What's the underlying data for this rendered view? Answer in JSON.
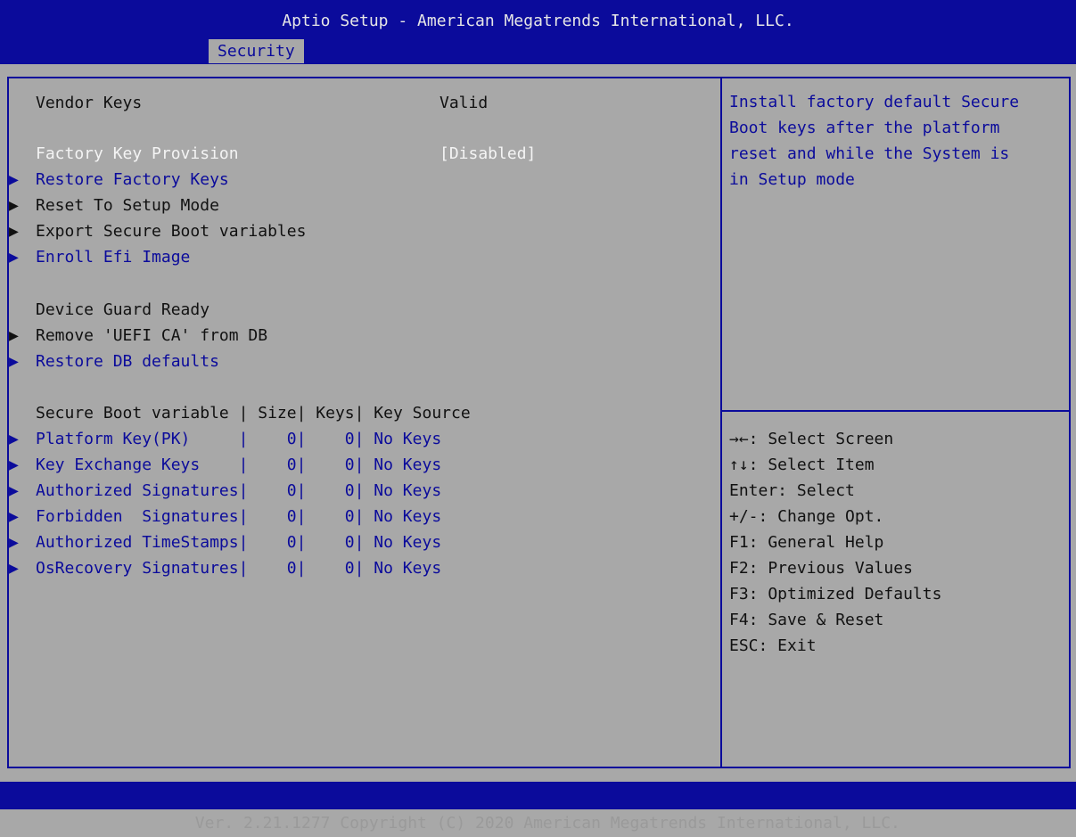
{
  "header": {
    "title": "Aptio Setup - American Megatrends International, LLC.",
    "active_tab": "Security"
  },
  "main": {
    "vendor_keys": {
      "label": "Vendor Keys",
      "value": "Valid"
    },
    "factory_key_provision": {
      "label": "Factory Key Provision",
      "value": "[Disabled]"
    },
    "submenus": [
      {
        "label": "Restore Factory Keys"
      },
      {
        "label": "Reset To Setup Mode"
      },
      {
        "label": "Export Secure Boot variables"
      },
      {
        "label": "Enroll Efi Image"
      }
    ],
    "device_guard": {
      "label": "Device Guard Ready"
    },
    "device_guard_items": [
      {
        "label": "Remove 'UEFI CA' from DB"
      },
      {
        "label": "Restore DB defaults"
      }
    ],
    "table_header": "Secure Boot variable | Size| Keys| Key Source",
    "variables": [
      {
        "text": "Platform Key(PK)     |    0|    0| No Keys"
      },
      {
        "text": "Key Exchange Keys    |    0|    0| No Keys"
      },
      {
        "text": "Authorized Signatures|    0|    0| No Keys"
      },
      {
        "text": "Forbidden  Signatures|    0|    0| No Keys"
      },
      {
        "text": "Authorized TimeStamps|    0|    0| No Keys"
      },
      {
        "text": "OsRecovery Signatures|    0|    0| No Keys"
      }
    ]
  },
  "help_panel": {
    "description": [
      "Install factory default Secure",
      "Boot keys after the platform",
      "reset and while the System is",
      "in Setup mode"
    ],
    "keys": [
      "→←: Select Screen",
      "↑↓: Select Item",
      "Enter: Select",
      "+/-: Change Opt.",
      "F1: General Help",
      "F2: Previous Values",
      "F3: Optimized Defaults",
      "F4: Save & Reset",
      "ESC: Exit"
    ]
  },
  "footer": {
    "text": "Ver. 2.21.1277 Copyright (C) 2020 American Megatrends International, LLC."
  },
  "icons": {
    "submenu_arrow": "▶"
  },
  "colors": {
    "accent": "#0b0b9b",
    "background": "#a8a8a8",
    "highlight_text": "#f4f4f4"
  }
}
